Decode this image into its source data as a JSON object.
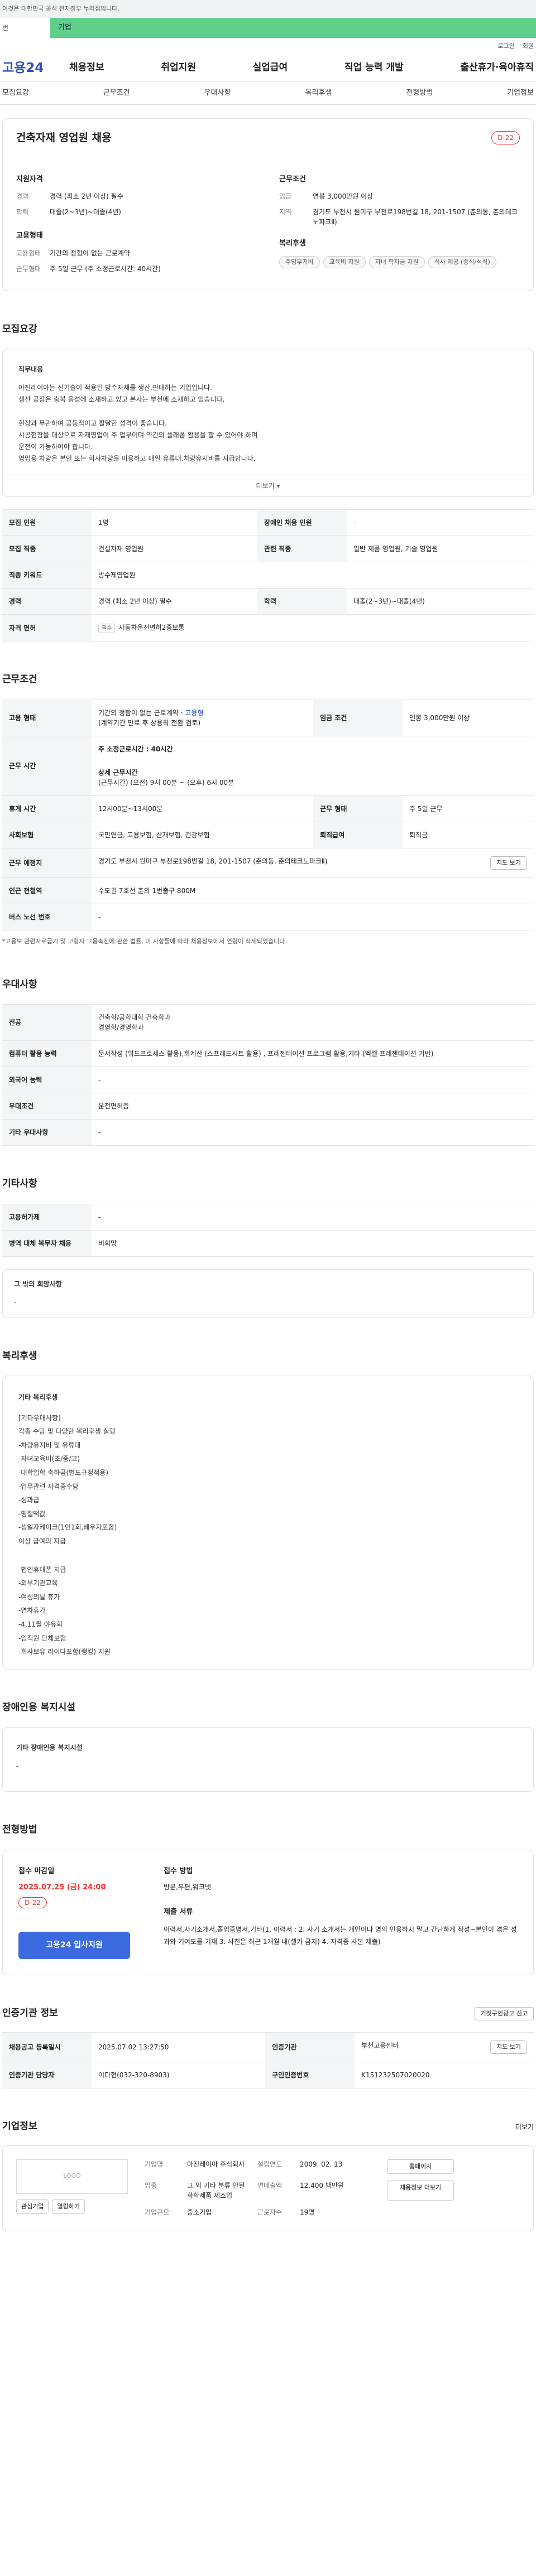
{
  "gov_notice": "이것은 대한민국 공식 전자정부 누리집입니다.",
  "ad": {
    "tab_label": "번",
    "banner": "기업"
  },
  "util": [
    "로그인",
    "회원"
  ],
  "logo": "고용24",
  "gnb": [
    "채용정보",
    "취업지원",
    "실업급여",
    "직업 능력 개발",
    "출산휴가·육아휴직"
  ],
  "tabs": [
    "모집요강",
    "근무조건",
    "우대사항",
    "복리후생",
    "전형방법",
    "기업정보"
  ],
  "summary": {
    "title": "건축자재 영업원 채용",
    "dday": "D-22",
    "support_h": "지원자격",
    "work_h": "근무조건",
    "emp_h": "고용형태",
    "welfare_h": "복리후생",
    "career_k": "경력",
    "career_v": "경력 (최소 2년 이상) 필수",
    "edu_k": "학력",
    "edu_v": "대졸(2~3년)~대졸(4년)",
    "wage_k": "임금",
    "wage_v": "연봉 3,000만원 이상",
    "loc_k": "지역",
    "loc_v": "경기도 부천시 원미구 부천로198번길 18, 201-1507 (춘의동, 춘의테크노파크Ⅱ)",
    "type_k": "고용형태",
    "type_v": "기간의 정함이 없는 근로계약",
    "hours_k": "근무형태",
    "hours_v": "주 5일 근무 (주 소정근로시간: 40시간)",
    "welfare": [
      "주임무지비",
      "교육비 지원",
      "자녀 학자금 지원",
      "식사 제공 (중식/석식)"
    ]
  },
  "recruit": {
    "title": "모집요강",
    "desc_h": "직무내용",
    "desc": [
      "아진레이아는 신기술이 적용된 방수자재를 생산,판매하는 기업입니다.",
      "생산 공장은 충북 음성에 소재하고 있고 본사는 부천에 소재하고 있습니다.",
      "",
      "현장과 무관하여 공동적이고 활달한 성격이 좋습니다.",
      "시공현장을 대상으로 자재영업이 주 업무이며 약간의 플래폼 활용을 할 수 있어야 하며",
      "운전이 가능하여야 합니다.",
      "영업용 차량은 본인 또는 회사차량을 이용하고 매일 유류대,차량유지비를 지급합니다."
    ],
    "more": "더보기",
    "rows": {
      "count_k": "모집 인원",
      "count_v": "1명",
      "disabled_k": "장애인 채용 인원",
      "disabled_v": "-",
      "job_k": "모집 직종",
      "job_v": "건설자재 영업원",
      "rel_k": "관련 직종",
      "rel_v": "일반 제품 영업원, 기술 영업원",
      "kw_k": "직종 키워드",
      "kw_v": "방수제영업원",
      "car_k": "경력",
      "car_v": "경력 (최소 2년 이상) 필수",
      "edu_k": "학력",
      "edu_v": "대졸(2~3년)~대졸(4년)",
      "lic_k": "자격 면허",
      "lic_badge": "필수",
      "lic_v": "자동차운전면허2종보통"
    }
  },
  "work": {
    "title": "근무조건",
    "type_k": "고용 형태",
    "type_v": "기간의 정함이 없는 근로계약 · ",
    "type_link": "고용형",
    "type_sub": "(계약기간 만료 후 상용직 전환 검토)",
    "wage_k": "임금 조건",
    "wage_v": "연봉 3,000만원 이상",
    "hours_k": "근무 시간",
    "hours_a": "주 소정근로시간 : 40시간",
    "hours_b": "상세 근무시간",
    "hours_c": "(근무시간) (오전) 9시 00분 ~ (오후) 6시 00분",
    "rest_k": "휴게 시간",
    "rest_v": "12시00분~13시00분",
    "form_k": "근무 형태",
    "form_v": "주 5일 근무",
    "ins_k": "사회보험",
    "ins_v": "국민연금, 고용보험, 산재보험, 건강보험",
    "ret_k": "퇴직급여",
    "ret_v": "퇴직금",
    "place_k": "근무 예정지",
    "place_v": "경기도 부천시 원미구 부천로198번길 18, 201-1507 (춘의동, 춘의테크노파크Ⅱ)",
    "map_btn": "지도 보기",
    "sub_k": "인근 전철역",
    "sub_v": "수도권 7호선 춘의 1번출구 800M",
    "bus_k": "버스 노선 번호",
    "bus_v": "-",
    "note": "*고용보 관련자료급기 및 고령자 고용촉진에 관한 법률,  이 사항들에 따라 채용정보에서 연령이 삭제되었습니다."
  },
  "pref": {
    "title": "우대사항",
    "major_k": "전공",
    "major_v": [
      "건축학/공학대학 건축학과",
      "경영학/경영학과"
    ],
    "comp_k": "컴퓨터 활용 능력",
    "comp_v": "문서작성 (워드프로세스 활용),회계산 (스프레드시트 활용) , 프레젠테이션 프로그램 활용,기타 (엑셀 프레젠테이션 기반)",
    "lang_k": "외국어 능력",
    "lang_v": "-",
    "cond_k": "우대조건",
    "cond_v": "운전면허증",
    "etc_k": "기타 우대사항",
    "etc_v": "-"
  },
  "other": {
    "title": "기타사항",
    "ins_k": "고용허가제",
    "ins_v": "-",
    "mil_k": "병역 대체 복무자 채용",
    "mil_v": "비희망",
    "hope_h": "그 밖의 희망사항",
    "hope_v": "-"
  },
  "welfare": {
    "title": "복리후생",
    "h": "기타 복리후생",
    "lines": [
      "[기타우대사항]",
      "각종 수당 및 다양한 복리후생 실행",
      "-차량유지비 및 유류대",
      "-자녀교육비(초/중/고)",
      "-대학입학 축하금(별도규정적용)",
      "-업무관련 자격증수당",
      "-성과급",
      "-명절떡값",
      "-생일자케이크(1인1회,배우자포함)",
      "이상 급여의 지급",
      "",
      "-법인휴대폰 지급",
      "-외부기관교육",
      "-여성의날 휴가",
      "-연차휴가",
      "-4,11월 야유회",
      "-임직원 단체보험",
      "-회사보유 라이다포함(랭킹) 지원"
    ]
  },
  "disabled": {
    "title": "장애인용 복지시설",
    "h": "기타 장애인용 복지시설",
    "v": "-"
  },
  "apply": {
    "title": "전형방법",
    "deadline_h": "접수 마감일",
    "deadline": "2025.07.25 (금) 24:00",
    "dday": "D-22",
    "btn": "고용24 입사지원",
    "method_h": "접수 방법",
    "method_v": "방문,우편,워크넷",
    "docs_h": "제출 서류",
    "docs_v": "이력서,자기소개서,졸업증명서,기타(1. 이력서 : 2. 자기 소개서는 개인이나 명의 인용하지 말고 간단하게 작성~본인이 겪은 성과와 기여도를 기재 3. 사진은 최근 1개월 내(셀카 금지) 4. 자격증 사본 제출)"
  },
  "agency": {
    "title": "인증기관 정보",
    "report_btn": "거짓구인광고 신고",
    "reg_k": "채용공고 등록일시",
    "reg_v": "2025.07.02 13:27:50",
    "org_k": "인증기관",
    "org_v": "부천고용센터",
    "map_btn": "지도 보기",
    "mgr_k": "인증기관 담당자",
    "mgr_v": "이다현(032-320-8903)",
    "id_k": "구인인증번호",
    "id_v": "K151232507020020"
  },
  "company": {
    "title": "기업정보",
    "more": "더보기",
    "logo": "LOGO",
    "fav_btn": "관심기업",
    "follow_btn": "열람하기",
    "name_k": "기업명",
    "name_v": "아진레이아 주식회사",
    "est_k": "설립연도",
    "est_v": "2009. 02. 13",
    "home_btn": "홈페이지",
    "biz_k": "업종",
    "biz_v": "그 외 기타 분류 안된 화학제품 제조업",
    "sales_k": "연매출액",
    "sales_v": "12,400 백만원",
    "other_btn": "채용정보 더보기",
    "emp_k": "근로자수",
    "emp_v": "19명",
    "size_k": "기업규모",
    "size_v": "중소기업"
  }
}
